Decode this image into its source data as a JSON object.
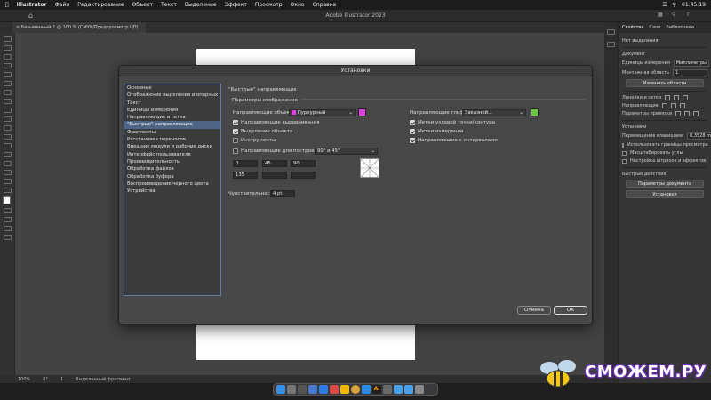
{
  "menubar": {
    "apple": "",
    "items": [
      "Illustrator",
      "Файл",
      "Редактирование",
      "Объект",
      "Текст",
      "Выделение",
      "Эффект",
      "Просмотр",
      "Окно",
      "Справка"
    ],
    "clock": "01:45:19"
  },
  "window": {
    "title": "Adobe Illustrator 2023"
  },
  "doc_tab": "Безымянный-1 @ 100 % (CMYK/Предпросмотр ЦП)",
  "status": {
    "zoom": "100%",
    "rotate": "0°",
    "page": "1",
    "mode": "Выделенный фрагмент"
  },
  "right_panel": {
    "tabs": [
      "Свойства",
      "Слои",
      "Библиотеки"
    ],
    "no_selection": "Нет выделения",
    "document_label": "Документ",
    "units_label": "Единицы измерения",
    "units_value": "Миллиметры",
    "artboard_label": "Монтажная область",
    "artboard_value": "1",
    "edit_artboards_btn": "Изменить области",
    "rulers_label": "Линейки и сетки",
    "guides_label": "Направляющие",
    "snap_label": "Параметры привязки",
    "prefs_label": "Установки",
    "nudge_label": "Перемещение клавишами",
    "nudge_value": "0,3528 mr",
    "scale_corners": "Масштабировать углы",
    "scale_strokes": "Настройка штрихов и эффектов",
    "quick_actions": "Быстрые действия",
    "doc_setup_btn": "Параметры документа",
    "prefs_btn": "Установки",
    "cb_use_preview": "Использовать границы просмотра"
  },
  "dialog": {
    "title": "Установки",
    "categories": [
      "Основные",
      "Отображение выделения и опорных точек",
      "Текст",
      "Единицы измерения",
      "Направляющие и сетка",
      "\"Быстрые\" направляющие",
      "Фрагменты",
      "Расстановка переносов",
      "Внешние модули и рабочие диски",
      "Интерфейс пользователя",
      "Производительность",
      "Обработка файлов",
      "Обработка буфера",
      "Воспроизведение черного цвета",
      "Устройства"
    ],
    "selected_index": 5,
    "section_title": "\"Быстрые\" направляющие",
    "group_title": "Параметры отображения",
    "object_guides_label": "Направляющие объекта:",
    "object_guides_value": "Пурпурный",
    "object_guides_color": "#e040e0",
    "glyph_guides_label": "Направляющие глифа:",
    "glyph_guides_value": "Заказной...",
    "glyph_guides_color": "#6cc644",
    "cb_align": "Направляющие выравнивания",
    "cb_highlight": "Выделение объекта",
    "cb_tools": "Инструменты",
    "cb_construct": "Направляющие для построения:",
    "construct_value": "90° и 45°",
    "cb_anchor": "Метки узловой точки/контура",
    "cb_measure": "Метки измерения",
    "cb_spacing": "Направляющие с интервалами",
    "angles": [
      "0",
      "45",
      "90",
      "135",
      "",
      ""
    ],
    "tolerance_label": "Чувствительность:",
    "tolerance_value": "4 pt",
    "cancel": "Отмена",
    "ok": "ОК"
  },
  "watermark": "СМОЖЕМ.РУ"
}
